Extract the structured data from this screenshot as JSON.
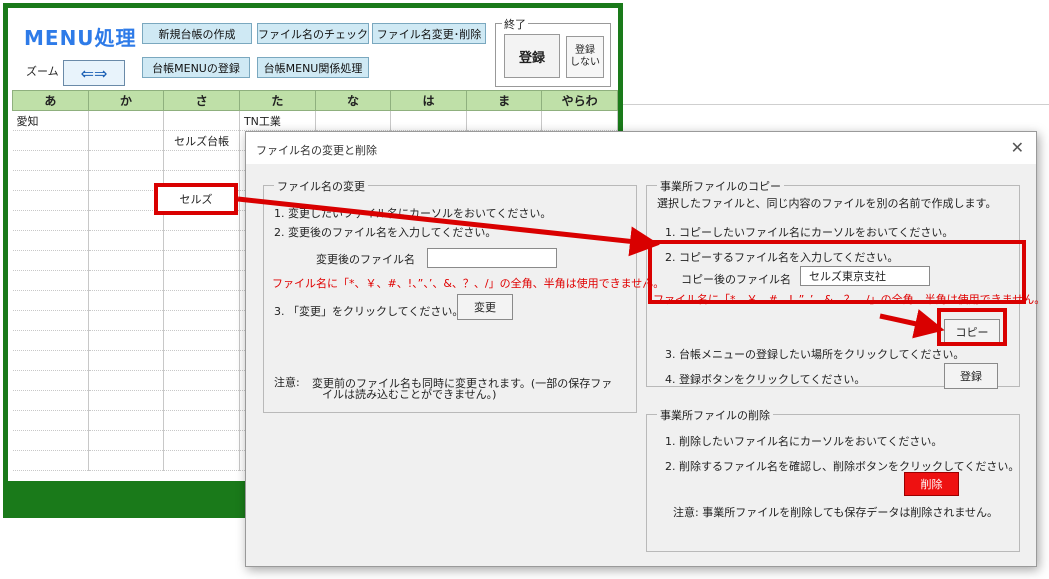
{
  "sheet": {
    "title": "MENU処理",
    "zoom_label": "ズーム",
    "zoom_arrows": "⇐⇒",
    "buttons": {
      "new_ledger": "新規台帳の作成",
      "check_filename": "ファイル名のチェック",
      "change_delete": "ファイル名変更･削除",
      "register_menu": "台帳MENUの登録",
      "menu_process": "台帳MENU関係処理"
    },
    "finish": {
      "legend": "終了",
      "register": "登録",
      "no_register_1": "登録",
      "no_register_2": "しない"
    },
    "columns": [
      "あ",
      "か",
      "さ",
      "た",
      "な",
      "は",
      "ま",
      "やらわ"
    ],
    "cells": {
      "aichi": "愛知",
      "tn": "TN工業",
      "selz_ledger": "セルズ台帳",
      "selz": "セルズ"
    }
  },
  "dialog": {
    "title": "ファイル名の変更と削除",
    "close": "✕",
    "rename": {
      "legend": "ファイル名の変更",
      "step1": "1. 変更したいファイル名にカーソルをおいてください。",
      "step2": "2. 変更後のファイル名を入力してください。",
      "field_label": "変更後のファイル名",
      "field_value": "",
      "warning": "ファイル名に「*、￥、#、!、”、’、&、？、/」の全角、半角は使用できません。",
      "step3": "3. 「変更」をクリックしてください。",
      "button": "変更",
      "note_label": "注意:",
      "note_line1": "変更前のファイル名も同時に変更されます。(一部の保存ファ",
      "note_line2": "イルは読み込むことができません。)"
    },
    "copy": {
      "legend": "事業所ファイルのコピー",
      "desc": "選択したファイルと、同じ内容のファイルを別の名前で作成します。",
      "step1": "1. コピーしたいファイル名にカーソルをおいてください。",
      "step2": "2. コピーするファイル名を入力してください。",
      "field_label": "コピー後のファイル名",
      "field_value": "セルズ東京支社",
      "warning": "ファイル名に「*、￥、#、!、”、’、&、？、/」の全角、半角は使用できません。",
      "button": "コピー",
      "step3": "3. 台帳メニューの登録したい場所をクリックしてください。",
      "step4": "4. 登録ボタンをクリックしてください。",
      "register_button": "登録"
    },
    "delete": {
      "legend": "事業所ファイルの削除",
      "step1": "1. 削除したいファイル名にカーソルをおいてください。",
      "step2": "2. 削除するファイル名を確認し、削除ボタンをクリックしてください。",
      "button": "削除",
      "note": "注意:  事業所ファイルを削除しても保存データは削除されません。"
    }
  },
  "colors": {
    "green_frame": "#1a7a1a",
    "highlight_red": "#d90000",
    "title_blue": "#2e7be8",
    "delete_red": "#ee1111"
  }
}
